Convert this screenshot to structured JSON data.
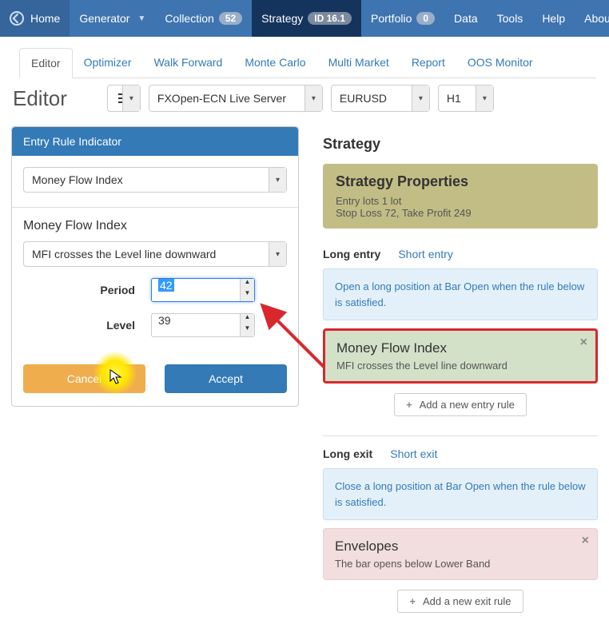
{
  "nav": {
    "home": "Home",
    "generator": "Generator",
    "collection": "Collection",
    "collection_badge": "52",
    "strategy": "Strategy",
    "strategy_badge": "ID 16.1",
    "portfolio": "Portfolio",
    "portfolio_badge": "0",
    "data": "Data",
    "tools": "Tools",
    "help": "Help",
    "about": "About"
  },
  "subtabs": {
    "editor": "Editor",
    "optimizer": "Optimizer",
    "walk_forward": "Walk Forward",
    "monte_carlo": "Monte Carlo",
    "multi_market": "Multi Market",
    "report": "Report",
    "oos_monitor": "OOS Monitor"
  },
  "editorbar": {
    "title": "Editor",
    "server": "FXOpen-ECN Live Server",
    "symbol": "EURUSD",
    "timeframe": "H1"
  },
  "panel": {
    "header": "Entry Rule Indicator",
    "indicator_select": "Money Flow Index",
    "section_title": "Money Flow Index",
    "condition_select": "MFI crosses the Level line downward",
    "period_label": "Period",
    "period_value": "42",
    "level_label": "Level",
    "level_value": "39",
    "cancel": "Cancel",
    "accept": "Accept"
  },
  "right": {
    "heading": "Strategy",
    "props_title": "Strategy Properties",
    "props_line1": "Entry lots 1 lot",
    "props_line2": "Stop Loss 72, Take Profit 249",
    "long_entry": "Long entry",
    "short_entry": "Short entry",
    "long_entry_desc": "Open a long position at Bar Open when the rule below is satisfied.",
    "rule1_title": "Money Flow Index",
    "rule1_sub": "MFI crosses the Level line downward",
    "add_entry_rule": "Add a new entry rule",
    "long_exit": "Long exit",
    "short_exit": "Short exit",
    "long_exit_desc": "Close a long position at Bar Open when the rule below is satisfied.",
    "rule2_title": "Envelopes",
    "rule2_sub": "The bar opens below Lower Band",
    "add_exit_rule": "Add a new exit rule"
  }
}
